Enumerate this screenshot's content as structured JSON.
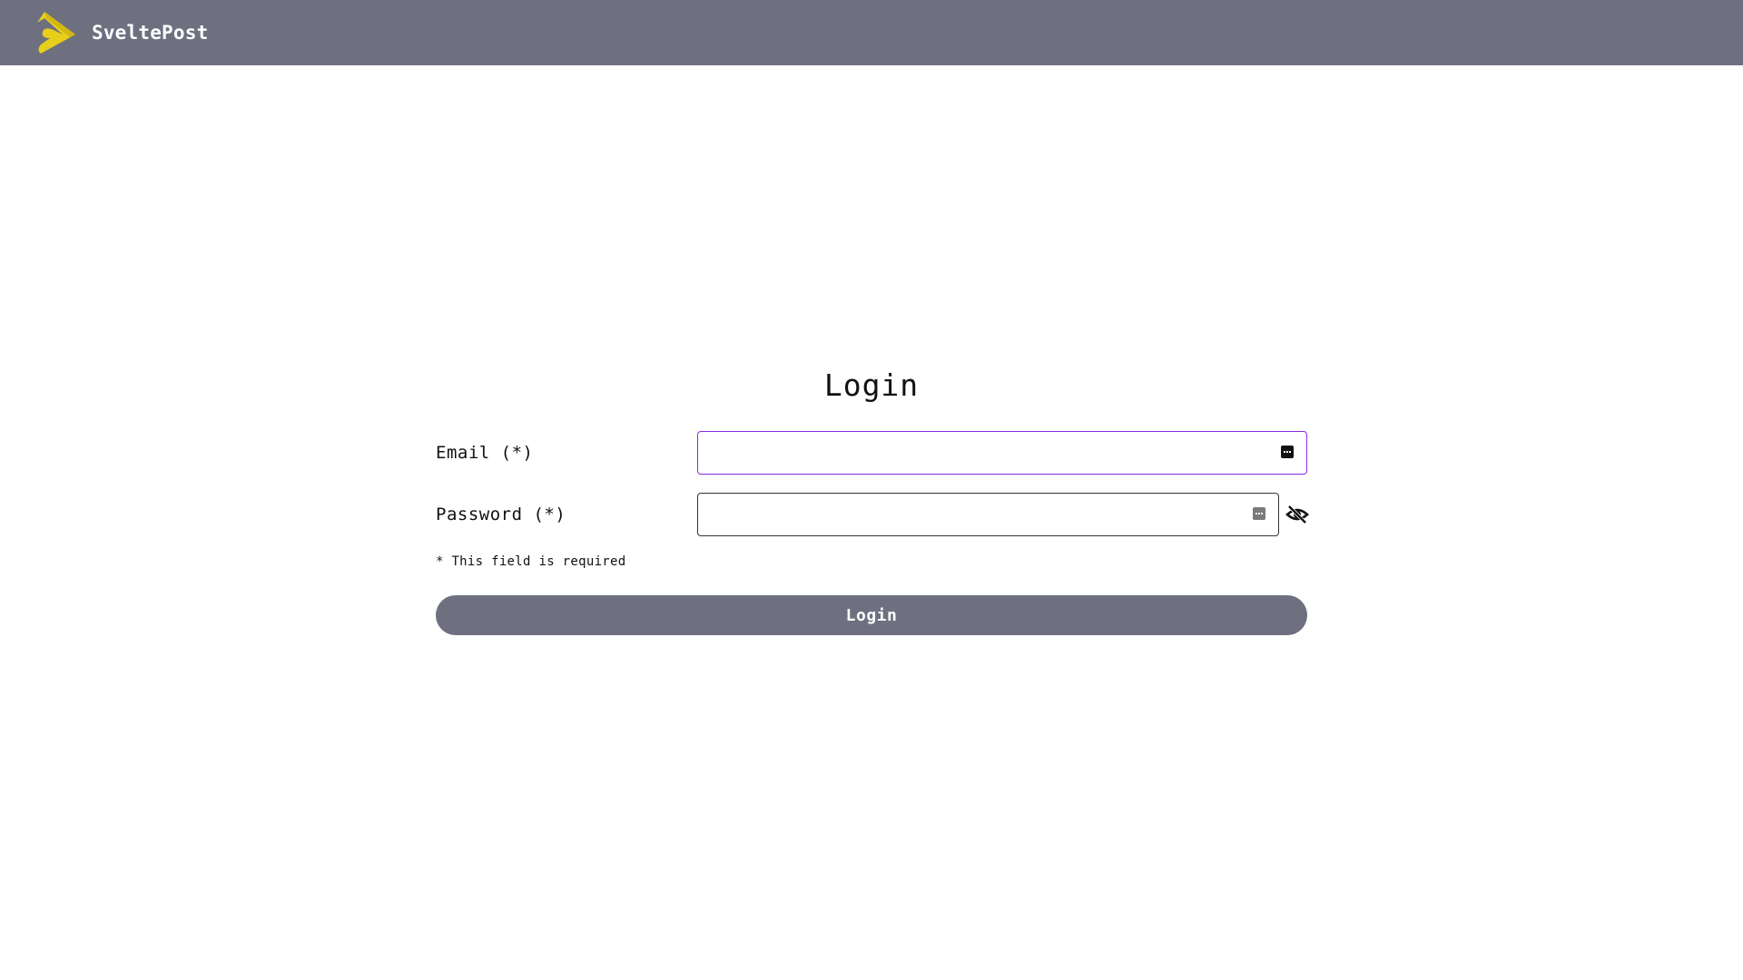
{
  "header": {
    "brand_name": "SveltePost",
    "logo_icon": "sveltepost-logo-icon",
    "background_color": "#6e7080",
    "logo_color": "#e8cf1c"
  },
  "login": {
    "title": "Login",
    "email": {
      "label": "Email (*)",
      "value": "",
      "placeholder": "",
      "icon": "password-manager-key-icon",
      "focused": true,
      "focus_border_color": "#8a2be2"
    },
    "password": {
      "label": "Password (*)",
      "value": "",
      "placeholder": "",
      "icon": "password-manager-key-icon",
      "toggle_icon": "eye-slash-icon"
    },
    "required_hint": "* This field is required",
    "submit_label": "Login",
    "button_color": "#6e7080"
  }
}
